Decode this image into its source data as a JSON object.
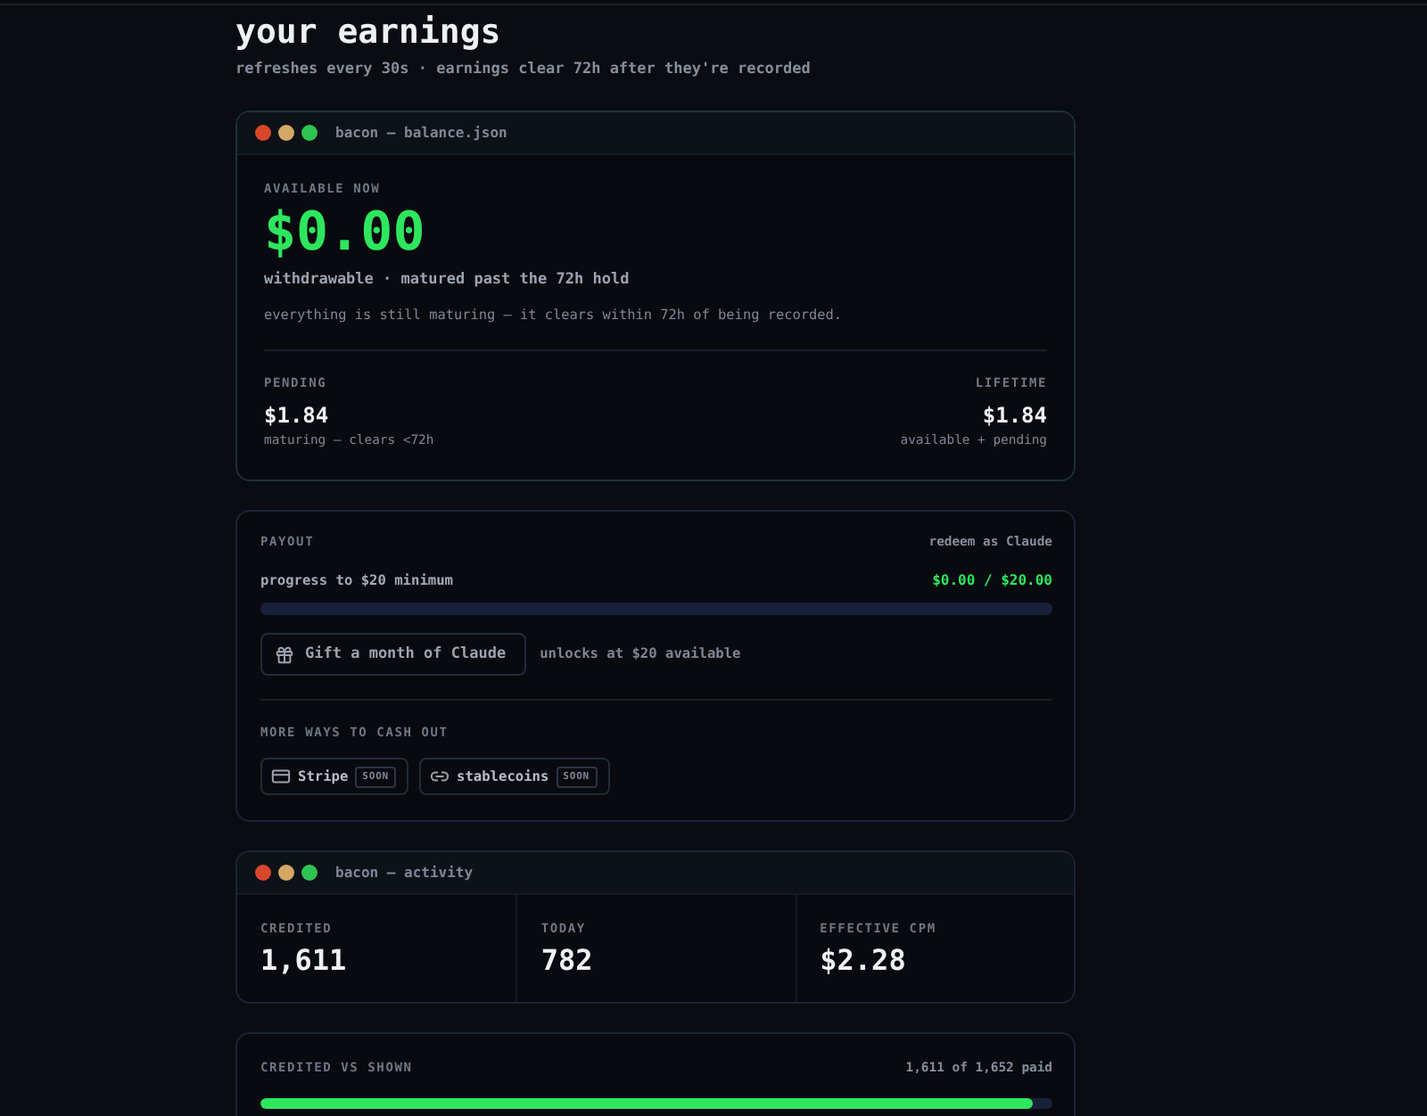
{
  "page": {
    "title": "your earnings",
    "subtitle": "refreshes every 30s · earnings clear 72h after they're recorded"
  },
  "balance_window": {
    "title": "bacon — balance.json",
    "available": {
      "label": "AVAILABLE NOW",
      "amount": "$0.00",
      "caption": "withdrawable · matured past the 72h hold",
      "note": "everything is still maturing — it clears within 72h of being recorded."
    },
    "totals": [
      {
        "label": "PENDING",
        "amount": "$1.84",
        "caption": "maturing — clears <72h"
      },
      {
        "label": "LIFETIME",
        "amount": "$1.84",
        "caption": "available + pending"
      }
    ]
  },
  "payout": {
    "label": "PAYOUT",
    "hint": "redeem as Claude",
    "progress": {
      "label": "progress to $20 minimum",
      "reading": "$0.00 / $20.00"
    },
    "gift_button": {
      "label": "Gift a month of Claude",
      "disabled": true
    },
    "unlock_note": "unlocks at $20 available",
    "more_label": "MORE WAYS TO CASH OUT",
    "methods": [
      {
        "kind": "card",
        "label": "Stripe",
        "badge": "SOON"
      },
      {
        "kind": "crypto",
        "label": "stablecoins",
        "badge": "SOON"
      }
    ]
  },
  "activity_window": {
    "title": "bacon — activity",
    "stats": [
      {
        "label": "CREDITED",
        "value": "1,611"
      },
      {
        "label": "TODAY",
        "value": "782"
      },
      {
        "label": "EFFECTIVE CPM",
        "value": "$2.28"
      }
    ]
  },
  "credited": {
    "label": "CREDITED VS SHOWN",
    "reading": "1,611 of 1,652 paid",
    "level": 0.975
  }
}
